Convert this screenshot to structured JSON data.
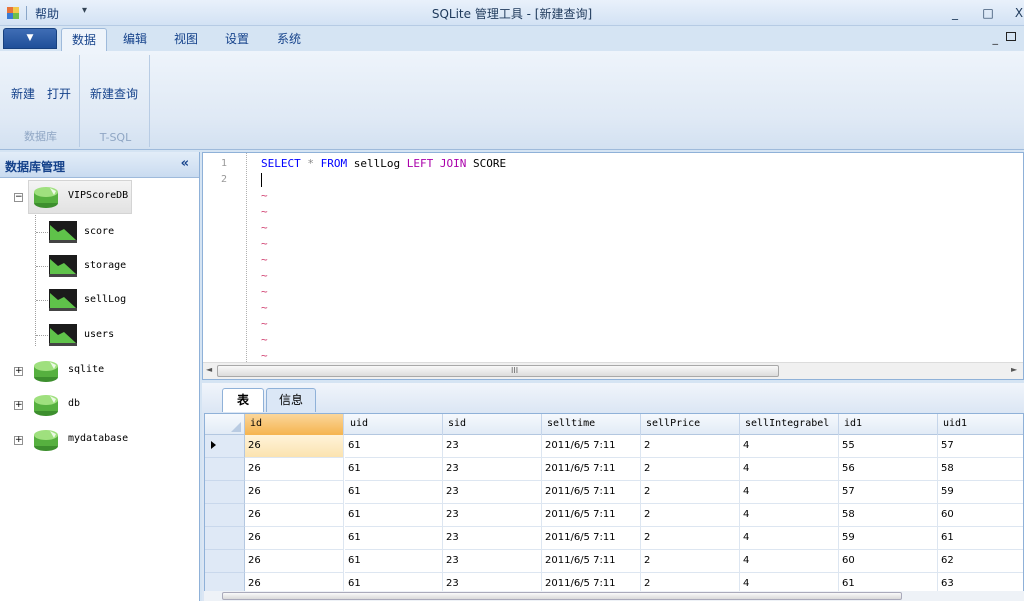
{
  "window": {
    "title": "SQLite 管理工具 - [新建查询]",
    "quick_access": "帮助",
    "quick_arrow": "▾",
    "minimize": "_",
    "maximize": "□",
    "close": "X"
  },
  "ribbon": {
    "app_menu_arrow": "▼",
    "tabs": [
      "数据",
      "编辑",
      "视图",
      "设置",
      "系统"
    ],
    "active_tab": "数据",
    "minimize_symbol": "_",
    "groups": [
      {
        "label": "数据库",
        "buttons": [
          "新建",
          "打开"
        ]
      },
      {
        "label": "T-SQL",
        "buttons": [
          "新建查询"
        ]
      }
    ]
  },
  "left_panel": {
    "title": "数据库管理",
    "collapse": "«",
    "databases": [
      {
        "name": "VIPScoreDB",
        "expanded": true,
        "tables": [
          "score",
          "storage",
          "sellLog",
          "users"
        ]
      },
      {
        "name": "sqlite",
        "expanded": false
      },
      {
        "name": "db",
        "expanded": false
      },
      {
        "name": "mydatabase",
        "expanded": false
      }
    ]
  },
  "editor": {
    "line_numbers": [
      "1",
      "2"
    ],
    "sql": {
      "select": "SELECT",
      "star": "*",
      "from": "FROM",
      "table1": "sellLog",
      "left": "LEFT",
      "join": "JOIN",
      "table2": "SCORE"
    },
    "tilde": "~",
    "scroll_grip": "III",
    "scroll_left": "◄",
    "scroll_right": "►"
  },
  "results": {
    "tabs": [
      "表",
      "信息"
    ],
    "active_tab": "表",
    "columns": [
      "id",
      "uid",
      "sid",
      "selltime",
      "sellPrice",
      "sellIntegrabel",
      "id1",
      "uid1"
    ],
    "rows": [
      [
        "26",
        "61",
        "23",
        "2011/6/5 7:11",
        "2",
        "4",
        "55",
        "57"
      ],
      [
        "26",
        "61",
        "23",
        "2011/6/5 7:11",
        "2",
        "4",
        "56",
        "58"
      ],
      [
        "26",
        "61",
        "23",
        "2011/6/5 7:11",
        "2",
        "4",
        "57",
        "59"
      ],
      [
        "26",
        "61",
        "23",
        "2011/6/5 7:11",
        "2",
        "4",
        "58",
        "60"
      ],
      [
        "26",
        "61",
        "23",
        "2011/6/5 7:11",
        "2",
        "4",
        "59",
        "61"
      ],
      [
        "26",
        "61",
        "23",
        "2011/6/5 7:11",
        "2",
        "4",
        "60",
        "62"
      ],
      [
        "26",
        "61",
        "23",
        "2011/6/5 7:11",
        "2",
        "4",
        "61",
        "63"
      ]
    ]
  },
  "colors": {
    "ribbon_text": "#15428b",
    "selected_header": "#f5b44f",
    "sql_keyword": "#0000ff",
    "sql_join": "#aa00aa",
    "tilde": "#d04070"
  }
}
